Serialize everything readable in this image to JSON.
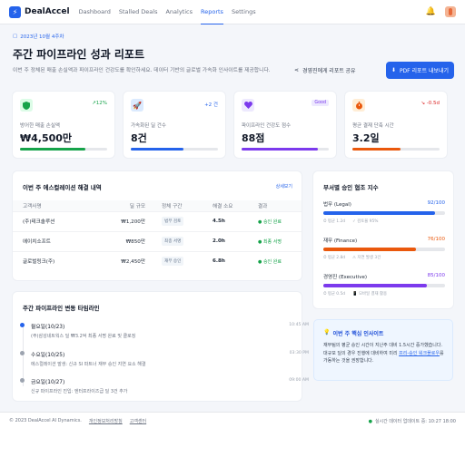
{
  "app": {
    "name": "DealAccel"
  },
  "nav": [
    "Dashboard",
    "Stalled Deals",
    "Analytics",
    "Reports",
    "Settings"
  ],
  "header": {
    "date": "2023년 10월 4주차",
    "title": "주간 파이프라인 성과 리포트",
    "desc": "이번 주 정체된 매출 손실액과 파이프라인 건강도를 확인하세요. 데이터 기반의 글로벌 가속화 인사이트를 제공합니다.",
    "share": "경영진에게 리포트 공유",
    "export": "PDF 리포트 내보내기"
  },
  "kpis": [
    {
      "label": "방어한 매출 손실액",
      "value": "₩4,500만",
      "delta": "↗12%",
      "color": "#16a34a",
      "icon_bg": "#dcfce7",
      "icon": "shield-icon",
      "progress": 0.75
    },
    {
      "label": "가속화된 딜 건수",
      "value": "8건",
      "delta": "+2 건",
      "color": "#2563eb",
      "icon_bg": "#dbeafe",
      "icon": "rocket-icon",
      "progress": 0.6
    },
    {
      "label": "파이프라인 건강도 점수",
      "value": "88점",
      "delta": "Good",
      "color": "#7c3aed",
      "icon_bg": "#ede9fe",
      "icon": "heart-icon",
      "progress": 0.88
    },
    {
      "label": "평균 결재 단축 시간",
      "value": "3.2일",
      "delta": "↘ -0.5d",
      "color": "#ea580c",
      "icon_bg": "#ffedd5",
      "icon": "stopwatch-icon",
      "progress": 0.55
    }
  ],
  "escalation": {
    "title": "이번 주 에스컬레이션 해결 내역",
    "link": "상세보기",
    "columns": [
      "고객사명",
      "딜 규모",
      "정체 구간",
      "해결 소요",
      "결과"
    ],
    "rows": [
      {
        "name": "(주)테크솔루션",
        "amount": "₩1,200만",
        "stage": "법무 검토",
        "time": "4.5h",
        "result": "승인 완료"
      },
      {
        "name": "에이치소프트",
        "amount": "₩850만",
        "stage": "최종 서명",
        "time": "2.0h",
        "result": "최종 서명"
      },
      {
        "name": "글로벌링크(주)",
        "amount": "₩2,450만",
        "stage": "재무 승인",
        "time": "6.8h",
        "result": "승인 완료"
      }
    ]
  },
  "timeline": {
    "title": "주간 파이프라인 변동 타임라인",
    "items": [
      {
        "title": "월요일(10/23)",
        "desc": "(주)삼성네트웍스 딜 ₩3.2억 최종 서명 완료 및 클로징",
        "time": "10:45 AM",
        "color": "#2563eb"
      },
      {
        "title": "수요일(10/25)",
        "desc": "에스컬레이션 발생: 신규 SI 파트너 재무 승인 지연 요소 해결",
        "time": "03:30 PM",
        "color": "#9ca3af"
      },
      {
        "title": "금요일(10/27)",
        "desc": "신규 파이프라인 진입: 엔터프라이즈급 딜 3건 추가",
        "time": "09:00 AM",
        "color": "#9ca3af"
      }
    ]
  },
  "departments": {
    "title": "부서별 승인 협조 지수",
    "items": [
      {
        "name": "법무 (Legal)",
        "score": "92/100",
        "progress": 0.92,
        "color": "#2563eb",
        "meta": [
          "평균 1.2d",
          "검토율 95%"
        ]
      },
      {
        "name": "재무 (Finance)",
        "score": "76/100",
        "progress": 0.76,
        "color": "#ea580c",
        "meta": [
          "평균 2.8d",
          "지연 발생 3건"
        ]
      },
      {
        "name": "경영진 (Executive)",
        "score": "85/100",
        "progress": 0.85,
        "color": "#7c3aed",
        "meta": [
          "평균 0.5d",
          "모바일 결재 활용"
        ]
      }
    ]
  },
  "insight": {
    "title": "이번 주 핵심 인사이트",
    "body_a": "재무팀의 평균 승인 시간이 지난주 대비 1.5시간 증가했습니다. 대규모 딜의 경우 진행에 대비하여 미리 ",
    "body_link": "프리-승인 워크플로우",
    "body_b": "를 가동하는 것을 권장합니다."
  },
  "footer": {
    "copyright": "© 2023 DealAccel AI Dynamics.",
    "links": [
      "개인정보처리방침",
      "고객센터"
    ],
    "status": "실시간 데이터 업데이트 중: 10:27 18:00"
  }
}
